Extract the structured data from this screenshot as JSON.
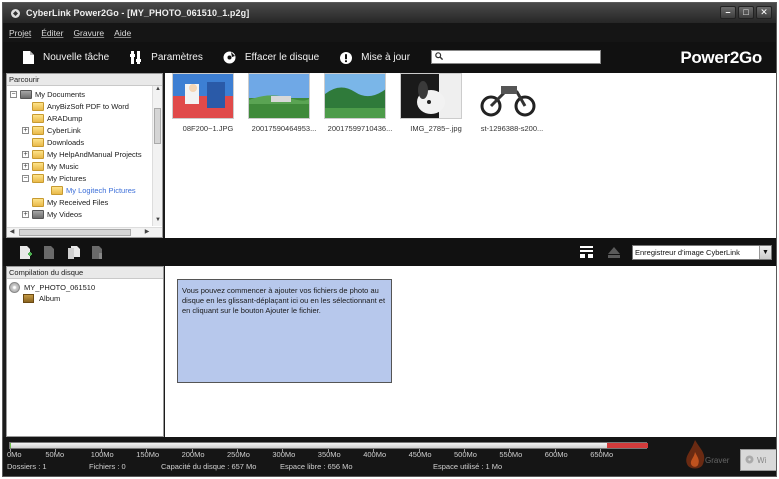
{
  "window": {
    "title": "CyberLink Power2Go - [MY_PHOTO_061510_1.p2g]"
  },
  "menu": [
    "Projet",
    "Éditer",
    "Gravure",
    "Aide"
  ],
  "toolbar": {
    "new_task": "Nouvelle tâche",
    "settings": "Paramètres",
    "erase_disc": "Effacer le disque",
    "update": "Mise à jour",
    "search_value": "",
    "brand": "Power2Go"
  },
  "browse": {
    "header": "Parcourir",
    "tree": [
      {
        "label": "My Documents",
        "expander": "−"
      },
      {
        "label": "AnyBizSoft PDF to Word",
        "expander": ""
      },
      {
        "label": "ARADump",
        "expander": ""
      },
      {
        "label": "CyberLink",
        "expander": "+"
      },
      {
        "label": "Downloads",
        "expander": ""
      },
      {
        "label": "My HelpAndManual Projects",
        "expander": "+"
      },
      {
        "label": "My Music",
        "expander": "+"
      },
      {
        "label": "My Pictures",
        "expander": "−"
      },
      {
        "label": "My Logitech Pictures",
        "expander": ""
      },
      {
        "label": "My Received Files",
        "expander": ""
      },
      {
        "label": "My Videos",
        "expander": "+"
      }
    ]
  },
  "thumbnails": [
    {
      "label": "08F200~1.JPG",
      "icon": "photo-thumbnail-icon"
    },
    {
      "label": "20017590464953...",
      "icon": "photo-thumbnail-icon"
    },
    {
      "label": "20017599710436...",
      "icon": "photo-thumbnail-icon"
    },
    {
      "label": "IMG_2785~.jpg",
      "icon": "photo-thumbnail-icon"
    },
    {
      "label": "st-1296388-s200...",
      "icon": "photo-thumbnail-icon"
    }
  ],
  "recorder": {
    "selected": "Enregistreur d'image CyberLink"
  },
  "compilation": {
    "header": "Compilation du disque",
    "disc_label": "MY_PHOTO_061510",
    "album_label": "Album",
    "hint": "Vous pouvez commencer à ajouter vos fichiers de photo au disque en les glissant-déplaçant ici ou en les sélectionnant et en cliquant sur le bouton Ajouter le fichier."
  },
  "capacity": {
    "ticks": [
      "0Mo",
      "50Mo",
      "100Mo",
      "150Mo",
      "200Mo",
      "250Mo",
      "300Mo",
      "350Mo",
      "400Mo",
      "450Mo",
      "500Mo",
      "550Mo",
      "600Mo",
      "650Mo"
    ],
    "folders": "Dossiers : 1",
    "files": "Fichiers : 0",
    "disc_capacity": "Capacité du disque : 657 Mo",
    "free_space": "Espace libre : 656 Mo",
    "used_space": "Espace utilisé : 1 Mo",
    "burn_label": "Graver",
    "burn_label_2": "Wi",
    "used_fraction": 0.0015
  }
}
